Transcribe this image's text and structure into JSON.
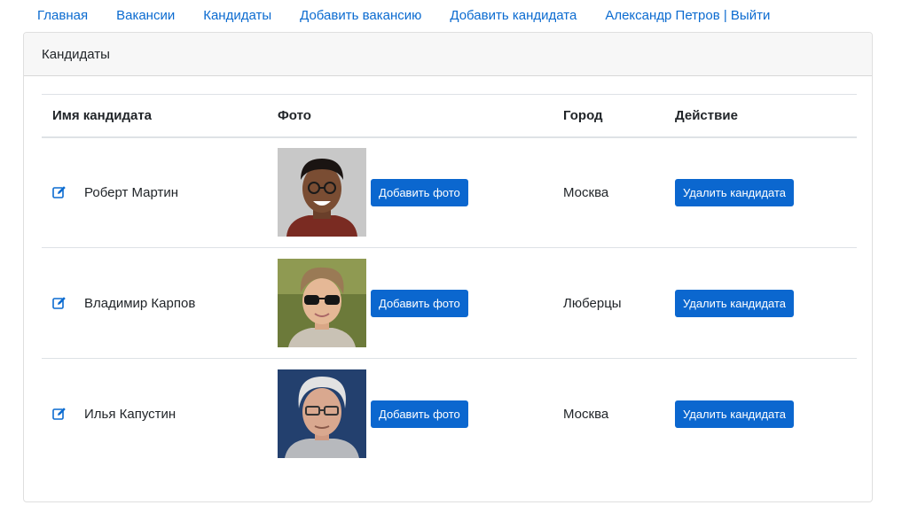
{
  "nav": {
    "items": [
      {
        "label": "Главная"
      },
      {
        "label": "Вакансии"
      },
      {
        "label": "Кандидаты"
      },
      {
        "label": "Добавить вакансию"
      },
      {
        "label": "Добавить кандидата"
      },
      {
        "label": "Александр Петров | Выйти"
      }
    ]
  },
  "card": {
    "title": "Кандидаты"
  },
  "table": {
    "headers": [
      "Имя кандидата",
      "Фото",
      "Город",
      "Действие"
    ],
    "rows": [
      {
        "name": "Роберт Мартин",
        "city": "Москва",
        "add_photo_label": "Добавить фото",
        "delete_label": "Удалить кандидата"
      },
      {
        "name": "Владимир Карпов",
        "city": "Люберцы",
        "add_photo_label": "Добавить фото",
        "delete_label": "Удалить кандидата"
      },
      {
        "name": "Илья Капустин",
        "city": "Москва",
        "add_photo_label": "Добавить фото",
        "delete_label": "Удалить кандидата"
      }
    ]
  },
  "icons": {
    "edit": "edit-icon"
  },
  "colors": {
    "link": "#0b6bd0",
    "button": "#0b67cf",
    "header_bg": "#f7f7f7"
  }
}
